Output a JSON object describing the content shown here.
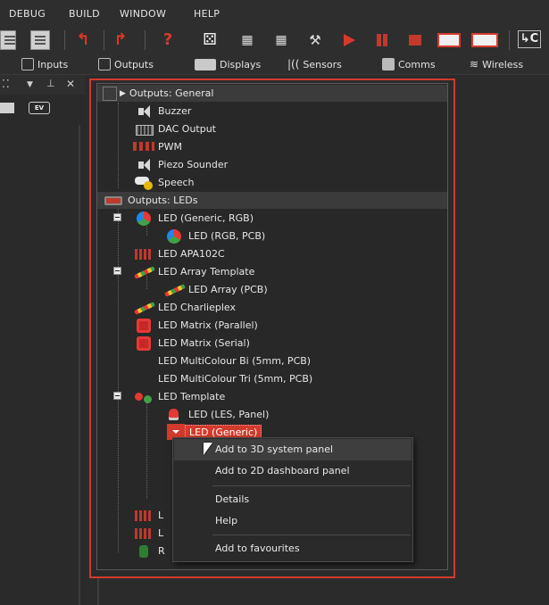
{
  "menubar": {
    "items": [
      "DEBUG",
      "BUILD",
      "WINDOW",
      "HELP"
    ]
  },
  "toolbar": {
    "icons": [
      "file-icon",
      "clipboard-icon",
      "undo-icon",
      "redo-icon",
      "help-icon",
      "dice-icon",
      "chip-icon",
      "chip-icon-2",
      "tools-icon",
      "play-icon",
      "pause-icon",
      "stop-icon",
      "step-into-icon",
      "step-over-icon",
      "code-icon"
    ]
  },
  "categories": {
    "inputs": "Inputs",
    "outputs": "Outputs",
    "displays": "Displays",
    "sensors": "Sensors",
    "comms": "Comms",
    "wireless": "Wireless"
  },
  "leftpanel": {
    "ev_label": "EV"
  },
  "tree": {
    "groups": [
      {
        "label": "Outputs: General"
      },
      {
        "label": "Outputs: LEDs"
      }
    ],
    "general_items": [
      "Buzzer",
      "DAC Output",
      "PWM",
      "Piezo Sounder",
      "Speech"
    ],
    "led_items": [
      "LED (Generic, RGB)",
      "LED (RGB, PCB)",
      "LED APA102C",
      "LED Array Template",
      "LED Array (PCB)",
      "LED Charlieplex",
      "LED Matrix (Parallel)",
      "LED Matrix (Serial)",
      "LED MultiColour Bi (5mm, PCB)",
      "LED MultiColour Tri (5mm, PCB)",
      "LED Template",
      "LED (LES, Panel)",
      "LED (Generic)"
    ],
    "truncated_items": [
      "L",
      "L",
      "R"
    ]
  },
  "context_menu": {
    "items": [
      "Add to 3D system panel",
      "Add to 2D dashboard panel",
      "Details",
      "Help",
      "Add to favourites"
    ]
  },
  "colors": {
    "accent": "#d23a2d",
    "background": "#2b2b2b",
    "group_bg": "#3b3b3b"
  }
}
